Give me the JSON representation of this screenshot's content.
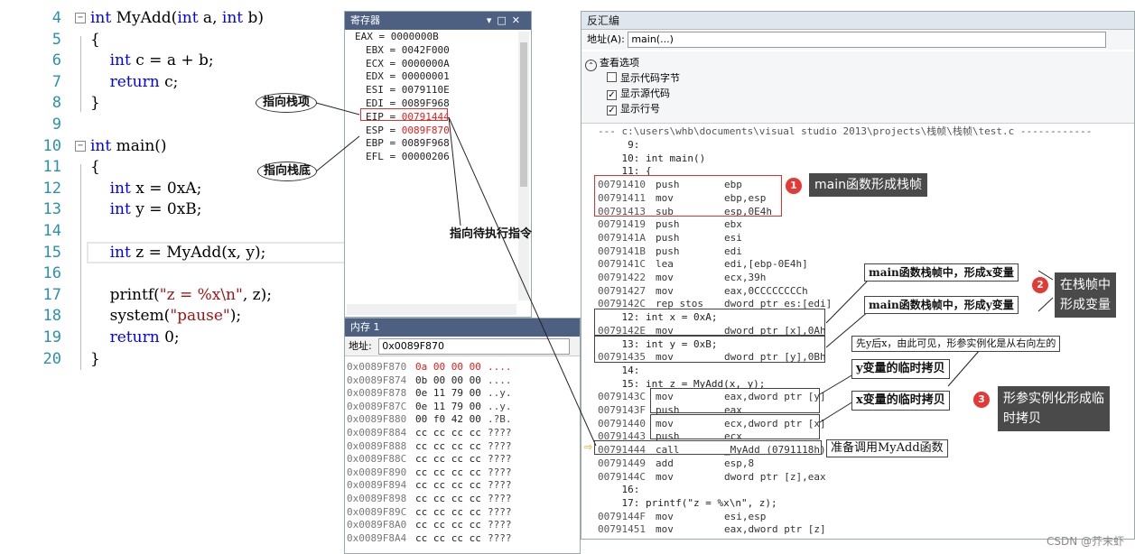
{
  "editor": {
    "lines": [
      {
        "num": "4",
        "code": "int MyAdd(int a, int b)"
      },
      {
        "num": "5",
        "code": "{"
      },
      {
        "num": "6",
        "code": "    int c = a + b;"
      },
      {
        "num": "7",
        "code": "    return c;"
      },
      {
        "num": "8",
        "code": "}"
      },
      {
        "num": "9",
        "code": ""
      },
      {
        "num": "10",
        "code": "int main()"
      },
      {
        "num": "11",
        "code": "{"
      },
      {
        "num": "12",
        "code": "    int x = 0xA;"
      },
      {
        "num": "13",
        "code": "    int y = 0xB;"
      },
      {
        "num": "14",
        "code": ""
      },
      {
        "num": "15",
        "code": "    int z = MyAdd(x, y);"
      },
      {
        "num": "16",
        "code": ""
      },
      {
        "num": "17",
        "code": "    printf(\"z = %x\\n\", z);"
      },
      {
        "num": "18",
        "code": "    system(\"pause\");"
      },
      {
        "num": "19",
        "code": "    return 0;"
      },
      {
        "num": "20",
        "code": "}"
      }
    ]
  },
  "registers": {
    "title": "寄存器",
    "lines": [
      "EAX = 0000000B",
      "EBX = 0042F000",
      "ECX = 0000000A",
      "EDX = 00000001",
      "ESI = 0079110E",
      "EDI = 0089F968",
      "EIP = 00791444",
      "ESP = 0089F870",
      "EBP = 0089F968",
      "EFL = 00000206"
    ]
  },
  "memory": {
    "title": "内存 1",
    "address_label": "地址:",
    "address_value": "0x0089F870",
    "rows": [
      {
        "addr": "0x0089F870",
        "bytes": "0a 00 00 00",
        "chars": "....",
        "red": true
      },
      {
        "addr": "0x0089F874",
        "bytes": "0b 00 00 00",
        "chars": "....",
        "red": false
      },
      {
        "addr": "0x0089F878",
        "bytes": "0e 11 79 00",
        "chars": "..y.",
        "red": false
      },
      {
        "addr": "0x0089F87C",
        "bytes": "0e 11 79 00",
        "chars": "..y.",
        "red": false
      },
      {
        "addr": "0x0089F880",
        "bytes": "00 f0 42 00",
        "chars": ".?B.",
        "red": false
      },
      {
        "addr": "0x0089F884",
        "bytes": "cc cc cc cc",
        "chars": "????",
        "red": false
      },
      {
        "addr": "0x0089F888",
        "bytes": "cc cc cc cc",
        "chars": "????",
        "red": false
      },
      {
        "addr": "0x0089F88C",
        "bytes": "cc cc cc cc",
        "chars": "????",
        "red": false
      },
      {
        "addr": "0x0089F890",
        "bytes": "cc cc cc cc",
        "chars": "????",
        "red": false
      },
      {
        "addr": "0x0089F894",
        "bytes": "cc cc cc cc",
        "chars": "????",
        "red": false
      },
      {
        "addr": "0x0089F898",
        "bytes": "cc cc cc cc",
        "chars": "????",
        "red": false
      },
      {
        "addr": "0x0089F89C",
        "bytes": "cc cc cc cc",
        "chars": "????",
        "red": false
      },
      {
        "addr": "0x0089F8A0",
        "bytes": "cc cc cc cc",
        "chars": "????",
        "red": false
      },
      {
        "addr": "0x0089F8A4",
        "bytes": "cc cc cc cc",
        "chars": "????",
        "red": false
      }
    ]
  },
  "disasm": {
    "title": "反汇编",
    "address_label": "地址(A):",
    "address_value": "main(...)",
    "view_options": "查看选项",
    "opt_code_bytes": "显示代码字节",
    "opt_source": "显示源代码",
    "opt_line_numbers": "显示行号",
    "file_line": "--- c:\\users\\whb\\documents\\visual studio 2013\\projects\\栈帧\\栈帧\\test.c ------------",
    "lines": [
      {
        "kind": "src",
        "text": "     9:"
      },
      {
        "kind": "src",
        "text": "    10: int main()"
      },
      {
        "kind": "src",
        "text": "    11: {"
      },
      {
        "kind": "asm",
        "ad": "00791410",
        "mn": "push",
        "op": "ebp"
      },
      {
        "kind": "asm",
        "ad": "00791411",
        "mn": "mov",
        "op": "ebp,esp"
      },
      {
        "kind": "asm",
        "ad": "00791413",
        "mn": "sub",
        "op": "esp,0E4h"
      },
      {
        "kind": "asm",
        "ad": "00791419",
        "mn": "push",
        "op": "ebx"
      },
      {
        "kind": "asm",
        "ad": "0079141A",
        "mn": "push",
        "op": "esi"
      },
      {
        "kind": "asm",
        "ad": "0079141B",
        "mn": "push",
        "op": "edi"
      },
      {
        "kind": "asm",
        "ad": "0079141C",
        "mn": "lea",
        "op": "edi,[ebp-0E4h]"
      },
      {
        "kind": "asm",
        "ad": "00791422",
        "mn": "mov",
        "op": "ecx,39h"
      },
      {
        "kind": "asm",
        "ad": "00791427",
        "mn": "mov",
        "op": "eax,0CCCCCCCCh"
      },
      {
        "kind": "asm",
        "ad": "0079142C",
        "mn": "rep stos",
        "op": "dword ptr es:[edi]"
      },
      {
        "kind": "src",
        "text": "    12: int x = 0xA;"
      },
      {
        "kind": "asm",
        "ad": "0079142E",
        "mn": "mov",
        "op": "dword ptr [x],0Ah"
      },
      {
        "kind": "src",
        "text": "    13: int y = 0xB;"
      },
      {
        "kind": "asm",
        "ad": "00791435",
        "mn": "mov",
        "op": "dword ptr [y],0Bh"
      },
      {
        "kind": "src",
        "text": "    14:"
      },
      {
        "kind": "src",
        "text": "    15: int z = MyAdd(x, y);"
      },
      {
        "kind": "asm",
        "ad": "0079143C",
        "mn": "mov",
        "op": "eax,dword ptr [y]"
      },
      {
        "kind": "asm",
        "ad": "0079143F",
        "mn": "push",
        "op": "eax"
      },
      {
        "kind": "asm",
        "ad": "00791440",
        "mn": "mov",
        "op": "ecx,dword ptr [x]"
      },
      {
        "kind": "asm",
        "ad": "00791443",
        "mn": "push",
        "op": "ecx"
      },
      {
        "kind": "asm",
        "ad": "00791444",
        "mn": "call",
        "op": "_MyAdd (0791118h)"
      },
      {
        "kind": "asm",
        "ad": "00791449",
        "mn": "add",
        "op": "esp,8"
      },
      {
        "kind": "asm",
        "ad": "0079144C",
        "mn": "mov",
        "op": "dword ptr [z],eax"
      },
      {
        "kind": "src",
        "text": "    16:"
      },
      {
        "kind": "src",
        "text": "    17: printf(\"z = %x\\n\", z);"
      },
      {
        "kind": "asm",
        "ad": "0079144F",
        "mn": "mov",
        "op": "esi,esp"
      },
      {
        "kind": "asm",
        "ad": "00791451",
        "mn": "mov",
        "op": "eax,dword ptr [z]"
      }
    ]
  },
  "annotations": {
    "points_stack_top": "指向栈项",
    "points_stack_bottom": "指向栈底",
    "points_next_instr": "指向待执行指令",
    "main_frame": "main函数形成栈帧",
    "main_frame_x": "main函数栈帧中，形成x变量",
    "main_frame_y": "main函数栈帧中，形成y变量",
    "in_frame_vars": "在栈帧中\n形成变量",
    "y_first": "先y后x，由此可见，形参实例化是从右向左的",
    "y_copy": "y变量的临时拷贝",
    "x_copy": "x变量的临时拷贝",
    "param_instances": "形参实例化形成临\n时拷贝",
    "call_myadd": "准备调用MyAdd函数",
    "n1": "1",
    "n2": "2",
    "n3": "3"
  },
  "watermark": "CSDN @芥末虾"
}
